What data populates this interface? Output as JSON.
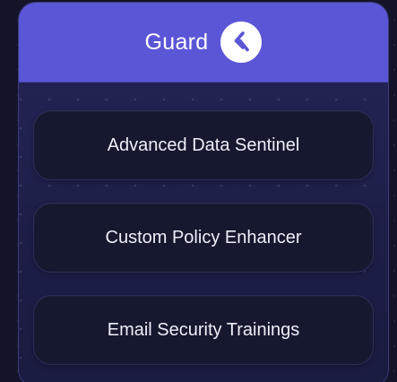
{
  "header": {
    "brand_name": "Guard",
    "logo_icon": "guard-logo-icon"
  },
  "menu": {
    "items": [
      {
        "label": "Advanced Data Sentinel"
      },
      {
        "label": "Custom Policy Enhancer"
      },
      {
        "label": "Email Security Trainings"
      }
    ]
  },
  "colors": {
    "header_bg": "#5b56d6",
    "card_bg": "#25265a",
    "item_bg": "#161830",
    "page_bg": "#13142a"
  }
}
